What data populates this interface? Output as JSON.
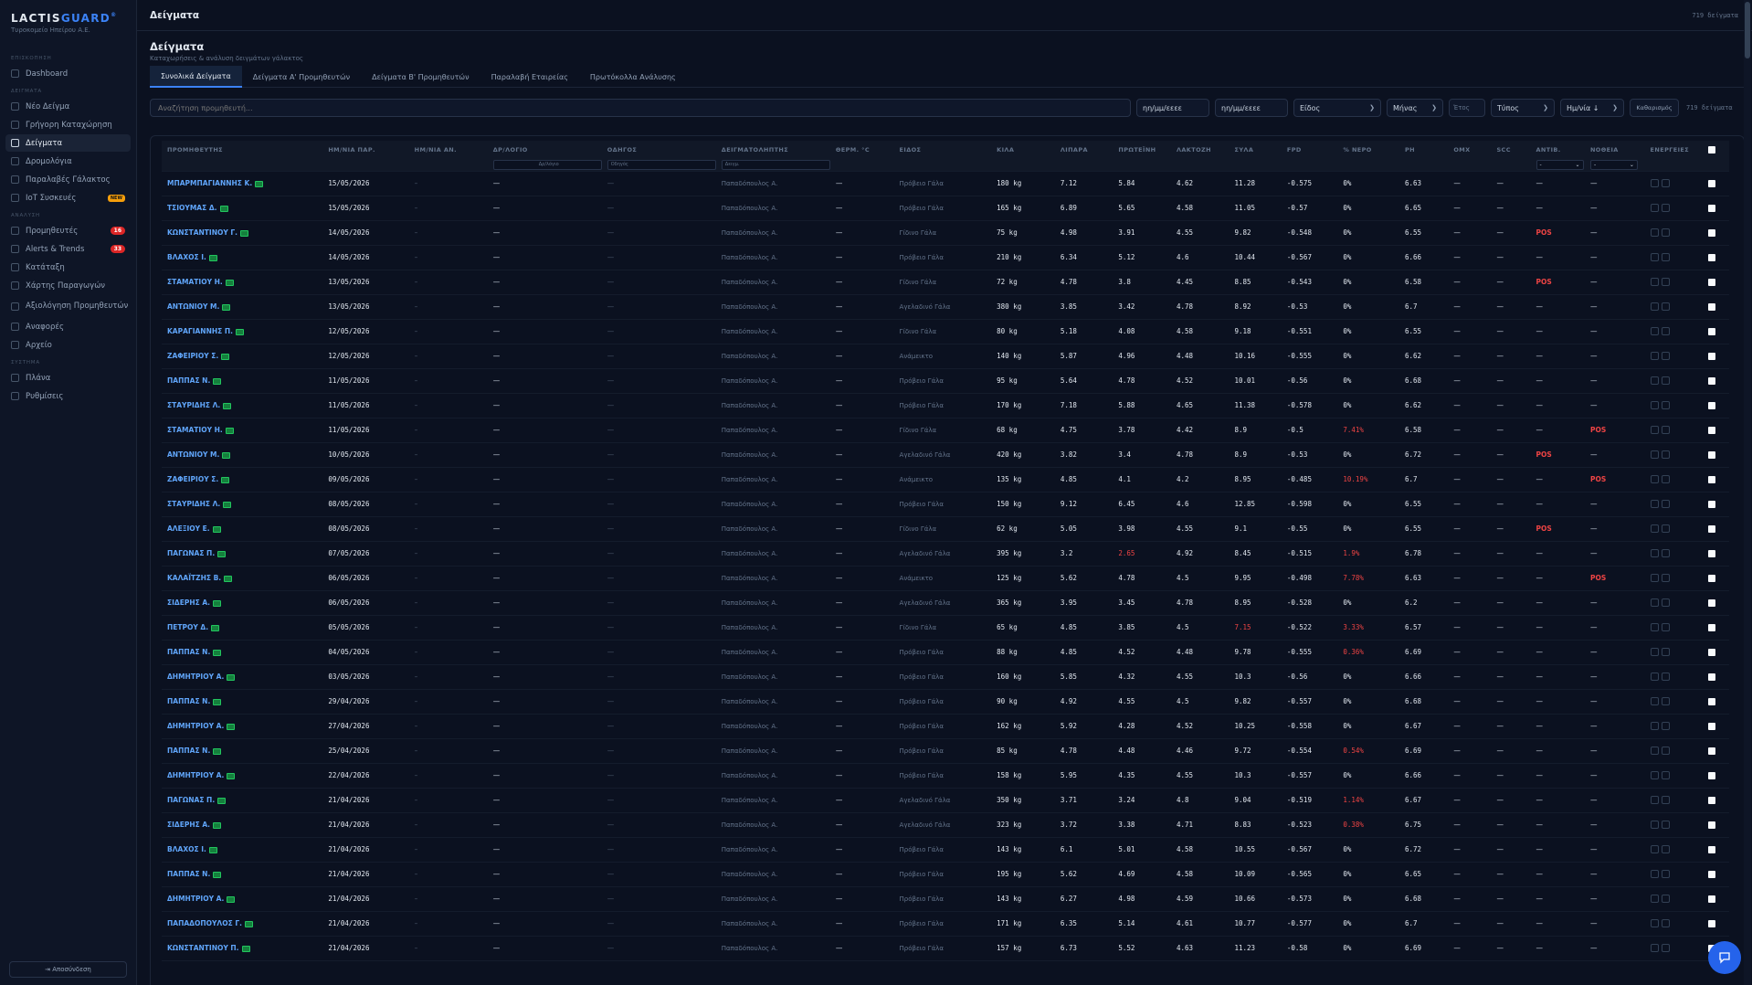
{
  "brand": {
    "name_a": "LACTIS",
    "name_b": "GUARD",
    "mark": "®",
    "subtitle": "Τυροκομείο Ηπείρου Α.Ε."
  },
  "sidebar": {
    "sections": [
      {
        "label": "ΕΠΙΣΚΟΠΗΣΗ",
        "items": [
          {
            "label": "Dashboard",
            "icon": "dashboard-icon"
          }
        ]
      },
      {
        "label": "ΔΕΙΓΜΑΤΑ",
        "items": [
          {
            "label": "Νέο Δείγμα",
            "icon": "plus-icon"
          },
          {
            "label": "Γρήγορη Καταχώρηση",
            "icon": "bolt-icon"
          },
          {
            "label": "Δείγματα",
            "icon": "list-icon",
            "active": true
          },
          {
            "label": "Δρομολόγια",
            "icon": "route-icon"
          },
          {
            "label": "Παραλαβές Γάλακτος",
            "icon": "truck-icon"
          },
          {
            "label": "IoT Συσκευές",
            "icon": "iot-icon",
            "badge_new": "NEW"
          }
        ]
      },
      {
        "label": "ΑΝΑΛΥΣΗ",
        "items": [
          {
            "label": "Προμηθευτές",
            "icon": "users-icon",
            "badge": "16"
          },
          {
            "label": "Alerts & Trends",
            "icon": "alert-icon",
            "badge": "33"
          },
          {
            "label": "Κατάταξη",
            "icon": "star-icon"
          },
          {
            "label": "Χάρτης Παραγωγών",
            "icon": "map-icon"
          },
          {
            "label": "Αξιολόγηση Προμηθευτών",
            "icon": "rating-icon",
            "tall": true
          },
          {
            "label": "Αναφορές",
            "icon": "report-icon"
          },
          {
            "label": "Αρχείο",
            "icon": "archive-icon"
          }
        ]
      },
      {
        "label": "ΣΥΣΤΗΜΑ",
        "items": [
          {
            "label": "Πλάνα",
            "icon": "plan-icon"
          },
          {
            "label": "Ρυθμίσεις",
            "icon": "gear-icon"
          }
        ]
      }
    ],
    "logout": "⇥ Αποσύνδεση"
  },
  "topbar": {
    "title": "Δείγματα",
    "count": "719 δείγματα"
  },
  "page": {
    "title": "Δείγματα",
    "subtitle": "Καταχωρήσεις & ανάλυση δειγμάτων γάλακτος"
  },
  "tabs": [
    {
      "label": "Συνολικά Δείγματα",
      "active": true
    },
    {
      "label": "Δείγματα Α' Προμηθευτών"
    },
    {
      "label": "Δείγματα Β' Προμηθευτών"
    },
    {
      "label": "Παραλαβή Εταιρείας"
    },
    {
      "label": "Πρωτόκολλα Ανάλυσης"
    }
  ],
  "filters": {
    "search_placeholder": "Αναζήτηση προμηθευτή...",
    "date_from": "ηη/μμ/εεεε",
    "date_to": "ηη/μμ/εεεε",
    "species": "Είδος",
    "month": "Μήνας",
    "year_placeholder": "Έτος",
    "type": "Τύπος",
    "sort": "Ημ/νία ↓",
    "clear": "Καθαρισμός",
    "count": "719 δείγματα"
  },
  "table": {
    "columns": [
      "ΠΡΟΜΗΘΕΥΤΗΣ",
      "ΗΜ/ΝΙΑ ΠΑΡ.",
      "ΗΜ/ΝΙΑ ΑΝ.",
      "ΔΡ/ΛΟΓΙΟ",
      "ΟΔΗΓΟΣ",
      "ΔΕΙΓΜΑΤΟΛΗΠΤΗΣ",
      "ΘΕΡΜ. °C",
      "ΕΙΔΟΣ",
      "ΚΙΛΑ",
      "ΛΙΠΑΡΑ",
      "ΠΡΩΤΕΪΝΗ",
      "ΛΑΚΤΟΖΗ",
      "ΣΥΛΑ",
      "FPD",
      "% ΝΕΡΟ",
      "PH",
      "ΟΜΧ",
      "SCC",
      "ΑΝΤΙΒ.",
      "ΝΟΘΕΙΑ",
      "ΕΝΕΡΓΕΙΕΣ"
    ],
    "filter_row": {
      "route_placeholder": "Δρ/λόγιο",
      "driver_placeholder": "Οδηγός",
      "sampler_placeholder": "Δειγμ.",
      "antib_select": "-",
      "adult_select": "-"
    },
    "rows": [
      [
        "ΜΠΑΡΜΠΑΓΙΑΝΝΗΣ Κ.",
        "15/05/2026",
        "–",
        "—",
        "—",
        "Παπαδόπουλος Α.",
        "—",
        "Πρόβειο Γάλα",
        "180 kg",
        "7.12",
        "5.84",
        "4.62",
        "11.28",
        "-0.575",
        "0%",
        "6.63",
        "—",
        "—",
        "—",
        "—"
      ],
      [
        "ΤΣΙΟΥΜΑΣ Δ.",
        "15/05/2026",
        "–",
        "—",
        "—",
        "Παπαδόπουλος Α.",
        "—",
        "Πρόβειο Γάλα",
        "165 kg",
        "6.89",
        "5.65",
        "4.58",
        "11.05",
        "-0.57",
        "0%",
        "6.65",
        "—",
        "—",
        "—",
        "—"
      ],
      [
        "ΚΩΝΣΤΑΝΤΙΝΟΥ Γ.",
        "14/05/2026",
        "–",
        "—",
        "—",
        "Παπαδόπουλος Α.",
        "—",
        "Γίδινο Γάλα",
        "75 kg",
        "4.98",
        "3.91",
        "4.55",
        "9.82",
        "-0.548",
        "0%",
        "6.55",
        "—",
        "—",
        "POS",
        "—"
      ],
      [
        "ΒΛΑΧΟΣ Ι.",
        "14/05/2026",
        "–",
        "—",
        "—",
        "Παπαδόπουλος Α.",
        "—",
        "Πρόβειο Γάλα",
        "210 kg",
        "6.34",
        "5.12",
        "4.6",
        "10.44",
        "-0.567",
        "0%",
        "6.66",
        "—",
        "—",
        "—",
        "—"
      ],
      [
        "ΣΤΑΜΑΤΙΟΥ Η.",
        "13/05/2026",
        "–",
        "—",
        "—",
        "Παπαδόπουλος Α.",
        "—",
        "Γίδινο Γάλα",
        "72 kg",
        "4.78",
        "3.8",
        "4.45",
        "8.85",
        "-0.543",
        "0%",
        "6.58",
        "—",
        "—",
        "POS",
        "—"
      ],
      [
        "ΑΝΤΩΝΙΟΥ Μ.",
        "13/05/2026",
        "–",
        "—",
        "—",
        "Παπαδόπουλος Α.",
        "—",
        "Αγελαδινό Γάλα",
        "380 kg",
        "3.85",
        "3.42",
        "4.78",
        "8.92",
        "-0.53",
        "0%",
        "6.7",
        "—",
        "—",
        "—",
        "—"
      ],
      [
        "ΚΑΡΑΓΙΑΝΝΗΣ Π.",
        "12/05/2026",
        "–",
        "—",
        "—",
        "Παπαδόπουλος Α.",
        "—",
        "Γίδινο Γάλα",
        "80 kg",
        "5.18",
        "4.08",
        "4.58",
        "9.18",
        "-0.551",
        "0%",
        "6.55",
        "—",
        "—",
        "—",
        "—"
      ],
      [
        "ΖΑΦΕΙΡΙΟΥ Σ.",
        "12/05/2026",
        "–",
        "—",
        "—",
        "Παπαδόπουλος Α.",
        "—",
        "Ανάμεικτο",
        "140 kg",
        "5.87",
        "4.96",
        "4.48",
        "10.16",
        "-0.555",
        "0%",
        "6.62",
        "—",
        "—",
        "—",
        "—"
      ],
      [
        "ΠΑΠΠΑΣ Ν.",
        "11/05/2026",
        "–",
        "—",
        "—",
        "Παπαδόπουλος Α.",
        "—",
        "Πρόβειο Γάλα",
        "95 kg",
        "5.64",
        "4.78",
        "4.52",
        "10.01",
        "-0.56",
        "0%",
        "6.68",
        "—",
        "—",
        "—",
        "—"
      ],
      [
        "ΣΤΑΥΡΙΔΗΣ Λ.",
        "11/05/2026",
        "–",
        "—",
        "—",
        "Παπαδόπουλος Α.",
        "—",
        "Πρόβειο Γάλα",
        "170 kg",
        "7.18",
        "5.88",
        "4.65",
        "11.38",
        "-0.578",
        "0%",
        "6.62",
        "—",
        "—",
        "—",
        "—"
      ],
      [
        "ΣΤΑΜΑΤΙΟΥ Η.",
        "11/05/2026",
        "–",
        "—",
        "—",
        "Παπαδόπουλος Α.",
        "—",
        "Γίδινο Γάλα",
        "68 kg",
        "4.75",
        "3.78",
        "4.42",
        "8.9",
        "-0.5",
        "7.41%",
        "6.58",
        "—",
        "—",
        "—",
        "POS"
      ],
      [
        "ΑΝΤΩΝΙΟΥ Μ.",
        "10/05/2026",
        "–",
        "—",
        "—",
        "Παπαδόπουλος Α.",
        "—",
        "Αγελαδινό Γάλα",
        "420 kg",
        "3.82",
        "3.4",
        "4.78",
        "8.9",
        "-0.53",
        "0%",
        "6.72",
        "—",
        "—",
        "POS",
        "—"
      ],
      [
        "ΖΑΦΕΙΡΙΟΥ Σ.",
        "09/05/2026",
        "–",
        "—",
        "—",
        "Παπαδόπουλος Α.",
        "—",
        "Ανάμεικτο",
        "135 kg",
        "4.85",
        "4.1",
        "4.2",
        "8.95",
        "-0.485",
        "10.19%",
        "6.7",
        "—",
        "—",
        "—",
        "POS"
      ],
      [
        "ΣΤΑΥΡΙΔΗΣ Λ.",
        "08/05/2026",
        "–",
        "—",
        "—",
        "Παπαδόπουλος Α.",
        "—",
        "Πρόβειο Γάλα",
        "150 kg",
        "9.12",
        "6.45",
        "4.6",
        "12.85",
        "-0.598",
        "0%",
        "6.55",
        "—",
        "—",
        "—",
        "—"
      ],
      [
        "ΑΛΕΞΙΟΥ Ε.",
        "08/05/2026",
        "–",
        "—",
        "—",
        "Παπαδόπουλος Α.",
        "—",
        "Γίδινο Γάλα",
        "62 kg",
        "5.05",
        "3.98",
        "4.55",
        "9.1",
        "-0.55",
        "0%",
        "6.55",
        "—",
        "—",
        "POS",
        "—"
      ],
      [
        "ΠΑΓΩΝΑΣ Π.",
        "07/05/2026",
        "–",
        "—",
        "—",
        "Παπαδόπουλος Α.",
        "—",
        "Αγελαδινό Γάλα",
        "395 kg",
        "3.2",
        "2.65",
        "4.92",
        "8.45",
        "-0.515",
        "1.9%",
        "6.78",
        "—",
        "—",
        "—",
        "—"
      ],
      [
        "ΚΑΛΑΪΤΖΗΣ Β.",
        "06/05/2026",
        "–",
        "—",
        "—",
        "Παπαδόπουλος Α.",
        "—",
        "Ανάμεικτο",
        "125 kg",
        "5.62",
        "4.78",
        "4.5",
        "9.95",
        "-0.498",
        "7.78%",
        "6.63",
        "—",
        "—",
        "—",
        "POS"
      ],
      [
        "ΣΙΔΕΡΗΣ Α.",
        "06/05/2026",
        "–",
        "—",
        "—",
        "Παπαδόπουλος Α.",
        "—",
        "Αγελαδινό Γάλα",
        "365 kg",
        "3.95",
        "3.45",
        "4.78",
        "8.95",
        "-0.528",
        "0%",
        "6.2",
        "—",
        "—",
        "—",
        "—"
      ],
      [
        "ΠΕΤΡΟΥ Δ.",
        "05/05/2026",
        "–",
        "—",
        "—",
        "Παπαδόπουλος Α.",
        "—",
        "Γίδινο Γάλα",
        "65 kg",
        "4.85",
        "3.85",
        "4.5",
        "7.15",
        "-0.522",
        "3.33%",
        "6.57",
        "—",
        "—",
        "—",
        "—"
      ],
      [
        "ΠΑΠΠΑΣ Ν.",
        "04/05/2026",
        "–",
        "—",
        "—",
        "Παπαδόπουλος Α.",
        "—",
        "Πρόβειο Γάλα",
        "88 kg",
        "4.85",
        "4.52",
        "4.48",
        "9.78",
        "-0.555",
        "0.36%",
        "6.69",
        "—",
        "—",
        "—",
        "—"
      ],
      [
        "ΔΗΜΗΤΡΙΟΥ Α.",
        "03/05/2026",
        "–",
        "—",
        "—",
        "Παπαδόπουλος Α.",
        "—",
        "Πρόβειο Γάλα",
        "160 kg",
        "5.85",
        "4.32",
        "4.55",
        "10.3",
        "-0.56",
        "0%",
        "6.66",
        "—",
        "—",
        "—",
        "—"
      ],
      [
        "ΠΑΠΠΑΣ Ν.",
        "29/04/2026",
        "–",
        "—",
        "—",
        "Παπαδόπουλος Α.",
        "—",
        "Πρόβειο Γάλα",
        "90 kg",
        "4.92",
        "4.55",
        "4.5",
        "9.82",
        "-0.557",
        "0%",
        "6.68",
        "—",
        "—",
        "—",
        "—"
      ],
      [
        "ΔΗΜΗΤΡΙΟΥ Α.",
        "27/04/2026",
        "–",
        "—",
        "—",
        "Παπαδόπουλος Α.",
        "—",
        "Πρόβειο Γάλα",
        "162 kg",
        "5.92",
        "4.28",
        "4.52",
        "10.25",
        "-0.558",
        "0%",
        "6.67",
        "—",
        "—",
        "—",
        "—"
      ],
      [
        "ΠΑΠΠΑΣ Ν.",
        "25/04/2026",
        "–",
        "—",
        "—",
        "Παπαδόπουλος Α.",
        "—",
        "Πρόβειο Γάλα",
        "85 kg",
        "4.78",
        "4.48",
        "4.46",
        "9.72",
        "-0.554",
        "0.54%",
        "6.69",
        "—",
        "—",
        "—",
        "—"
      ],
      [
        "ΔΗΜΗΤΡΙΟΥ Α.",
        "22/04/2026",
        "–",
        "—",
        "—",
        "Παπαδόπουλος Α.",
        "—",
        "Πρόβειο Γάλα",
        "158 kg",
        "5.95",
        "4.35",
        "4.55",
        "10.3",
        "-0.557",
        "0%",
        "6.66",
        "—",
        "—",
        "—",
        "—"
      ],
      [
        "ΠΑΓΩΝΑΣ Π.",
        "21/04/2026",
        "–",
        "—",
        "—",
        "Παπαδόπουλος Α.",
        "—",
        "Αγελαδινό Γάλα",
        "350 kg",
        "3.71",
        "3.24",
        "4.8",
        "9.04",
        "-0.519",
        "1.14%",
        "6.67",
        "—",
        "—",
        "—",
        "—"
      ],
      [
        "ΣΙΔΕΡΗΣ Α.",
        "21/04/2026",
        "–",
        "—",
        "—",
        "Παπαδόπουλος Α.",
        "—",
        "Αγελαδινό Γάλα",
        "323 kg",
        "3.72",
        "3.38",
        "4.71",
        "8.83",
        "-0.523",
        "0.38%",
        "6.75",
        "—",
        "—",
        "—",
        "—"
      ],
      [
        "ΒΛΑΧΟΣ Ι.",
        "21/04/2026",
        "–",
        "—",
        "—",
        "Παπαδόπουλος Α.",
        "—",
        "Πρόβειο Γάλα",
        "143 kg",
        "6.1",
        "5.01",
        "4.58",
        "10.55",
        "-0.567",
        "0%",
        "6.72",
        "—",
        "—",
        "—",
        "—"
      ],
      [
        "ΠΑΠΠΑΣ Ν.",
        "21/04/2026",
        "–",
        "—",
        "—",
        "Παπαδόπουλος Α.",
        "—",
        "Πρόβειο Γάλα",
        "195 kg",
        "5.62",
        "4.69",
        "4.58",
        "10.09",
        "-0.565",
        "0%",
        "6.65",
        "—",
        "—",
        "—",
        "—"
      ],
      [
        "ΔΗΜΗΤΡΙΟΥ Α.",
        "21/04/2026",
        "–",
        "—",
        "—",
        "Παπαδόπουλος Α.",
        "—",
        "Πρόβειο Γάλα",
        "143 kg",
        "6.27",
        "4.98",
        "4.59",
        "10.66",
        "-0.573",
        "0%",
        "6.68",
        "—",
        "—",
        "—",
        "—"
      ],
      [
        "ΠΑΠΑΔΟΠΟΥΛΟΣ Γ.",
        "21/04/2026",
        "–",
        "—",
        "—",
        "Παπαδόπουλος Α.",
        "—",
        "Πρόβειο Γάλα",
        "171 kg",
        "6.35",
        "5.14",
        "4.61",
        "10.77",
        "-0.577",
        "0%",
        "6.7",
        "—",
        "—",
        "—",
        "—"
      ],
      [
        "ΚΩΝΣΤΑΝΤΙΝΟΥ Π.",
        "21/04/2026",
        "–",
        "—",
        "—",
        "Παπαδόπουλος Α.",
        "—",
        "Πρόβειο Γάλα",
        "157 kg",
        "6.73",
        "5.52",
        "4.63",
        "11.23",
        "-0.58",
        "0%",
        "6.69",
        "—",
        "—",
        "—",
        "—"
      ]
    ],
    "red_cells": {
      "15_10": true,
      "18_12": true
    }
  },
  "colors": {
    "accent": "#3b82f6",
    "danger": "#ef4444",
    "background": "#0b1120",
    "sidebar": "#0e1526"
  }
}
